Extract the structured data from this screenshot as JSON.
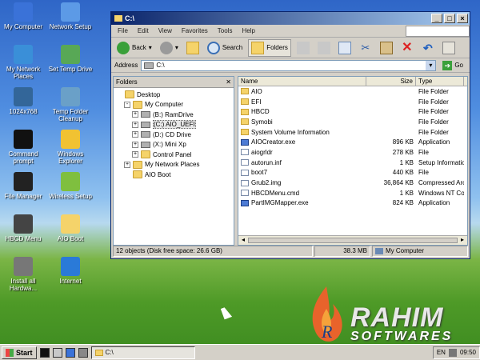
{
  "desktop": {
    "icons": [
      {
        "label": "My Computer",
        "icon": "computer-icon",
        "color": "#3a72d8"
      },
      {
        "label": "Network Setup",
        "icon": "network-icon",
        "color": "#5c9ae6"
      },
      {
        "label": "My Network Places",
        "icon": "network-places-icon",
        "color": "#3a8fd8"
      },
      {
        "label": "Set Temp Drive",
        "icon": "drive-icon",
        "color": "#58a856"
      },
      {
        "label": "1024x768",
        "icon": "monitor-icon",
        "color": "#336699"
      },
      {
        "label": "Temp Folder Cleanup",
        "icon": "recycle-icon",
        "color": "#6aa0c8"
      },
      {
        "label": "Command prompt",
        "icon": "terminal-icon",
        "color": "#111111"
      },
      {
        "label": "Windows Explorer",
        "icon": "explorer-icon",
        "color": "#f1c232"
      },
      {
        "label": "File Manager",
        "icon": "7z-icon",
        "color": "#222222"
      },
      {
        "label": "Wireless Setup",
        "icon": "wireless-icon",
        "color": "#7fbf3f"
      },
      {
        "label": "HBCD Menu",
        "icon": "tools-icon",
        "color": "#444444"
      },
      {
        "label": "AIO Boot",
        "icon": "folder-icon",
        "color": "#f5d36a"
      },
      {
        "label": "Install all Hardwa...",
        "icon": "hardware-icon",
        "color": "#777777"
      },
      {
        "label": "Internet",
        "icon": "ie-icon",
        "color": "#2a7ad8"
      }
    ]
  },
  "window": {
    "title": "C:\\",
    "menu": [
      "File",
      "Edit",
      "View",
      "Favorites",
      "Tools",
      "Help"
    ],
    "toolbar": {
      "back": "Back",
      "search": "Search",
      "folders": "Folders"
    },
    "address_label": "Address",
    "address_value": "C:\\",
    "go_label": "Go",
    "folders_header": "Folders",
    "tree": [
      {
        "label": "Desktop",
        "indent": 0,
        "expander": ""
      },
      {
        "label": "My Computer",
        "indent": 1,
        "expander": "-"
      },
      {
        "label": "(B:) RamDrive",
        "indent": 2,
        "expander": "+"
      },
      {
        "label": "(C:) AIO_UEFI",
        "indent": 2,
        "expander": "+",
        "selected": true
      },
      {
        "label": "(D:) CD Drive",
        "indent": 2,
        "expander": "+"
      },
      {
        "label": "(X:) Mini Xp",
        "indent": 2,
        "expander": "+"
      },
      {
        "label": "Control Panel",
        "indent": 2,
        "expander": "+"
      },
      {
        "label": "My Network Places",
        "indent": 1,
        "expander": "+"
      },
      {
        "label": "AIO Boot",
        "indent": 1,
        "expander": ""
      }
    ],
    "columns": {
      "name": "Name",
      "size": "Size",
      "type": "Type"
    },
    "files": [
      {
        "name": "AIO",
        "size": "",
        "type": "File Folder",
        "kind": "folder"
      },
      {
        "name": "EFI",
        "size": "",
        "type": "File Folder",
        "kind": "folder"
      },
      {
        "name": "HBCD",
        "size": "",
        "type": "File Folder",
        "kind": "folder"
      },
      {
        "name": "Symobi",
        "size": "",
        "type": "File Folder",
        "kind": "folder"
      },
      {
        "name": "System Volume Information",
        "size": "",
        "type": "File Folder",
        "kind": "folder"
      },
      {
        "name": "AIOCreator.exe",
        "size": "896 KB",
        "type": "Application",
        "kind": "app"
      },
      {
        "name": "aiogrldr",
        "size": "278 KB",
        "type": "File",
        "kind": "file"
      },
      {
        "name": "autorun.inf",
        "size": "1 KB",
        "type": "Setup Information",
        "kind": "file"
      },
      {
        "name": "boot7",
        "size": "440 KB",
        "type": "File",
        "kind": "file"
      },
      {
        "name": "Grub2.img",
        "size": "36,864 KB",
        "type": "Compressed Arch",
        "kind": "file"
      },
      {
        "name": "HBCDMenu.cmd",
        "size": "1 KB",
        "type": "Windows NT Cor",
        "kind": "file"
      },
      {
        "name": "PartIMGMapper.exe",
        "size": "824 KB",
        "type": "Application",
        "kind": "app"
      }
    ],
    "status": {
      "objects": "12 objects (Disk free space: 26.6 GB)",
      "size": "38.3 MB",
      "location": "My Computer"
    }
  },
  "taskbar": {
    "start": "Start",
    "task_title": "C:\\",
    "lang": "EN",
    "clock": "09:50"
  },
  "watermark": {
    "line1": "RAHIM",
    "line2": "SOFTWARES"
  }
}
